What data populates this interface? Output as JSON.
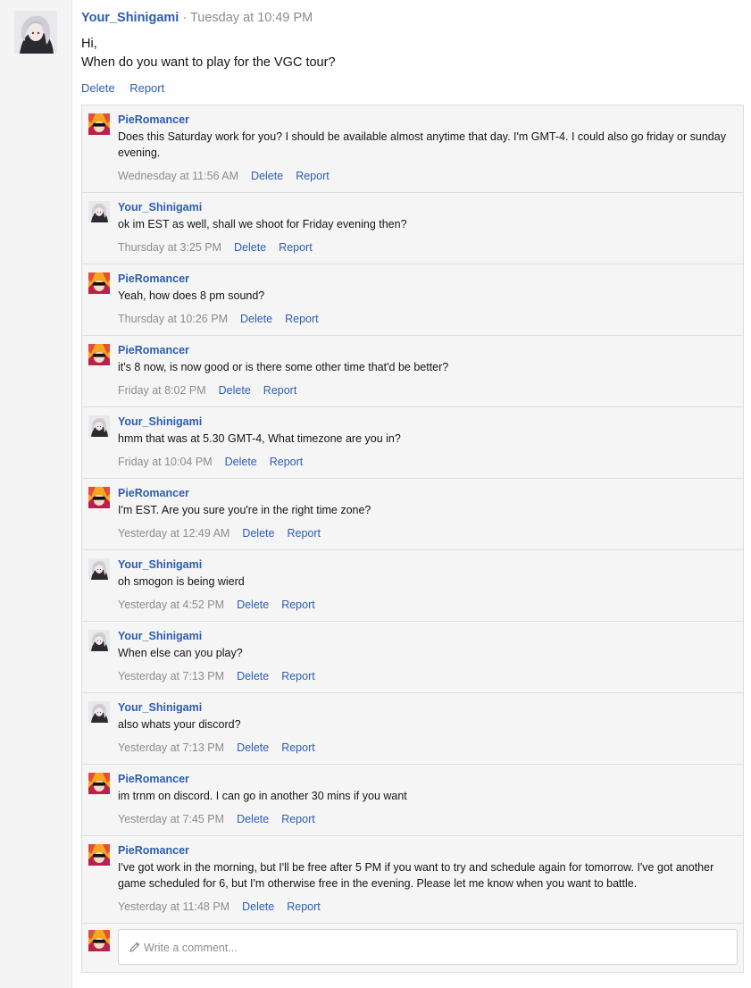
{
  "colors": {
    "link": "#2d5db0",
    "muted": "#8c8c8c",
    "text": "#141414",
    "comment_bg": "#f5f5f5",
    "border": "#dedede",
    "sidebar_bg": "#f4f4f4"
  },
  "post": {
    "author": "Your_Shinigami",
    "separator": "·",
    "date": "Tuesday at 10:49 PM",
    "body_line1": "Hi,",
    "body_line2": "When do you want to play for the VGC tour?",
    "delete_label": "Delete",
    "report_label": "Report",
    "avatar_icon": "anime-avatar-icon"
  },
  "comments": [
    {
      "author": "PieRomancer",
      "avatar": "sunglasses-avatar-icon",
      "text": "Does this Saturday work for you? I should be available almost anytime that day. I'm GMT-4. I could also go friday or sunday evening.",
      "date": "Wednesday at 11:56 AM",
      "delete_label": "Delete",
      "report_label": "Report"
    },
    {
      "author": "Your_Shinigami",
      "avatar": "anime-avatar-icon",
      "text": "ok im EST as well, shall we shoot for Friday evening then?",
      "date": "Thursday at 3:25 PM",
      "delete_label": "Delete",
      "report_label": "Report"
    },
    {
      "author": "PieRomancer",
      "avatar": "sunglasses-avatar-icon",
      "text": "Yeah, how does 8 pm sound?",
      "date": "Thursday at 10:26 PM",
      "delete_label": "Delete",
      "report_label": "Report"
    },
    {
      "author": "PieRomancer",
      "avatar": "sunglasses-avatar-icon",
      "text": "it's 8 now, is now good or is there some other time that'd be better?",
      "date": "Friday at 8:02 PM",
      "delete_label": "Delete",
      "report_label": "Report"
    },
    {
      "author": "Your_Shinigami",
      "avatar": "anime-avatar-icon",
      "text": "hmm that was at 5.30 GMT-4, What timezone are you in?",
      "date": "Friday at 10:04 PM",
      "delete_label": "Delete",
      "report_label": "Report"
    },
    {
      "author": "PieRomancer",
      "avatar": "sunglasses-avatar-icon",
      "text": "I'm EST. Are you sure you're in the right time zone?",
      "date": "Yesterday at 12:49 AM",
      "delete_label": "Delete",
      "report_label": "Report"
    },
    {
      "author": "Your_Shinigami",
      "avatar": "anime-avatar-icon",
      "text": "oh smogon is being wierd",
      "date": "Yesterday at 4:52 PM",
      "delete_label": "Delete",
      "report_label": "Report"
    },
    {
      "author": "Your_Shinigami",
      "avatar": "anime-avatar-icon",
      "text": "When else can you play?",
      "date": "Yesterday at 7:13 PM",
      "delete_label": "Delete",
      "report_label": "Report"
    },
    {
      "author": "Your_Shinigami",
      "avatar": "anime-avatar-icon",
      "text": "also whats your discord?",
      "date": "Yesterday at 7:13 PM",
      "delete_label": "Delete",
      "report_label": "Report"
    },
    {
      "author": "PieRomancer",
      "avatar": "sunglasses-avatar-icon",
      "text": "im trnm on discord. I can go in another 30 mins if you want",
      "date": "Yesterday at 7:45 PM",
      "delete_label": "Delete",
      "report_label": "Report"
    },
    {
      "author": "PieRomancer",
      "avatar": "sunglasses-avatar-icon",
      "text": "I've got work in the morning, but I'll be free after 5 PM if you want to try and schedule again for tomorrow. I've got another game scheduled for 6, but I'm otherwise free in the evening. Please let me know when you want to battle.",
      "date": "Yesterday at 11:48 PM",
      "delete_label": "Delete",
      "report_label": "Report"
    }
  ],
  "compose": {
    "placeholder": "Write a comment...",
    "pencil_icon": "pencil-icon",
    "avatar": "sunglasses-avatar-icon"
  }
}
